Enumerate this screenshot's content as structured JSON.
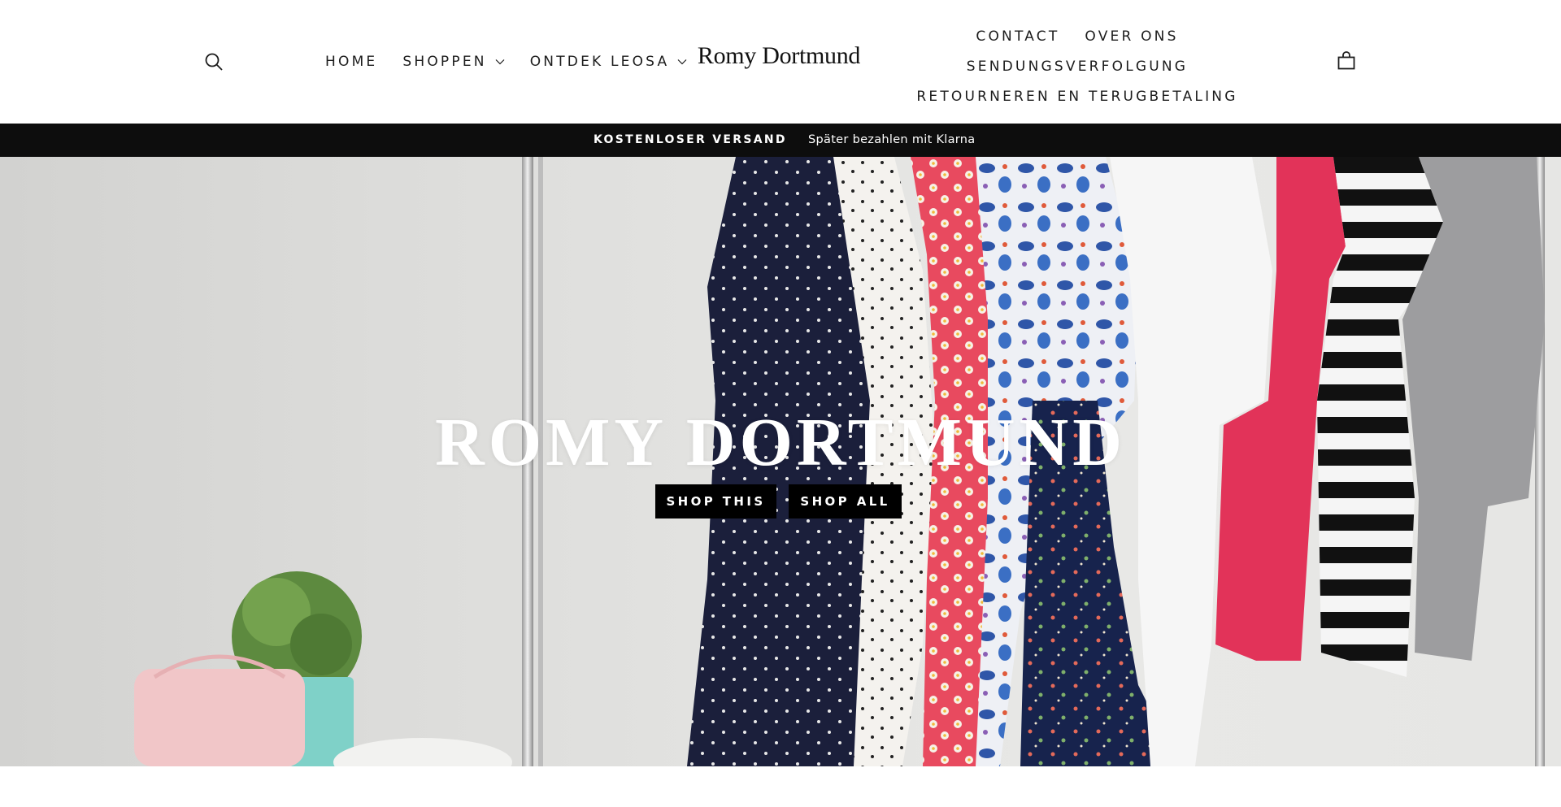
{
  "header": {
    "logo": "Romy Dortmund",
    "search_icon": "search-icon",
    "cart_icon": "shopping-bag-icon",
    "nav_left": [
      {
        "label": "HOME",
        "has_dropdown": false
      },
      {
        "label": "SHOPPEN",
        "has_dropdown": true
      },
      {
        "label": "ONTDEK LEOSA",
        "has_dropdown": true
      }
    ],
    "nav_right": {
      "contact": "CONTACT",
      "over_ons": "OVER ONS",
      "tracking": "SENDUNGSVERFOLGUNG",
      "returns": "RETOURNEREN EN TERUGBETALING"
    }
  },
  "announcement": {
    "primary": "KOSTENLOSER VERSAND",
    "secondary": "Später bezahlen mit Klarna"
  },
  "hero": {
    "title": "ROMY DORTMUND",
    "buttons": {
      "shop_this": "SHOP THIS",
      "shop_all": "SHOP ALL"
    }
  },
  "colors": {
    "announcement_bg": "#0d0d0d",
    "button_bg": "#000000",
    "text": "#1c1c1c"
  }
}
